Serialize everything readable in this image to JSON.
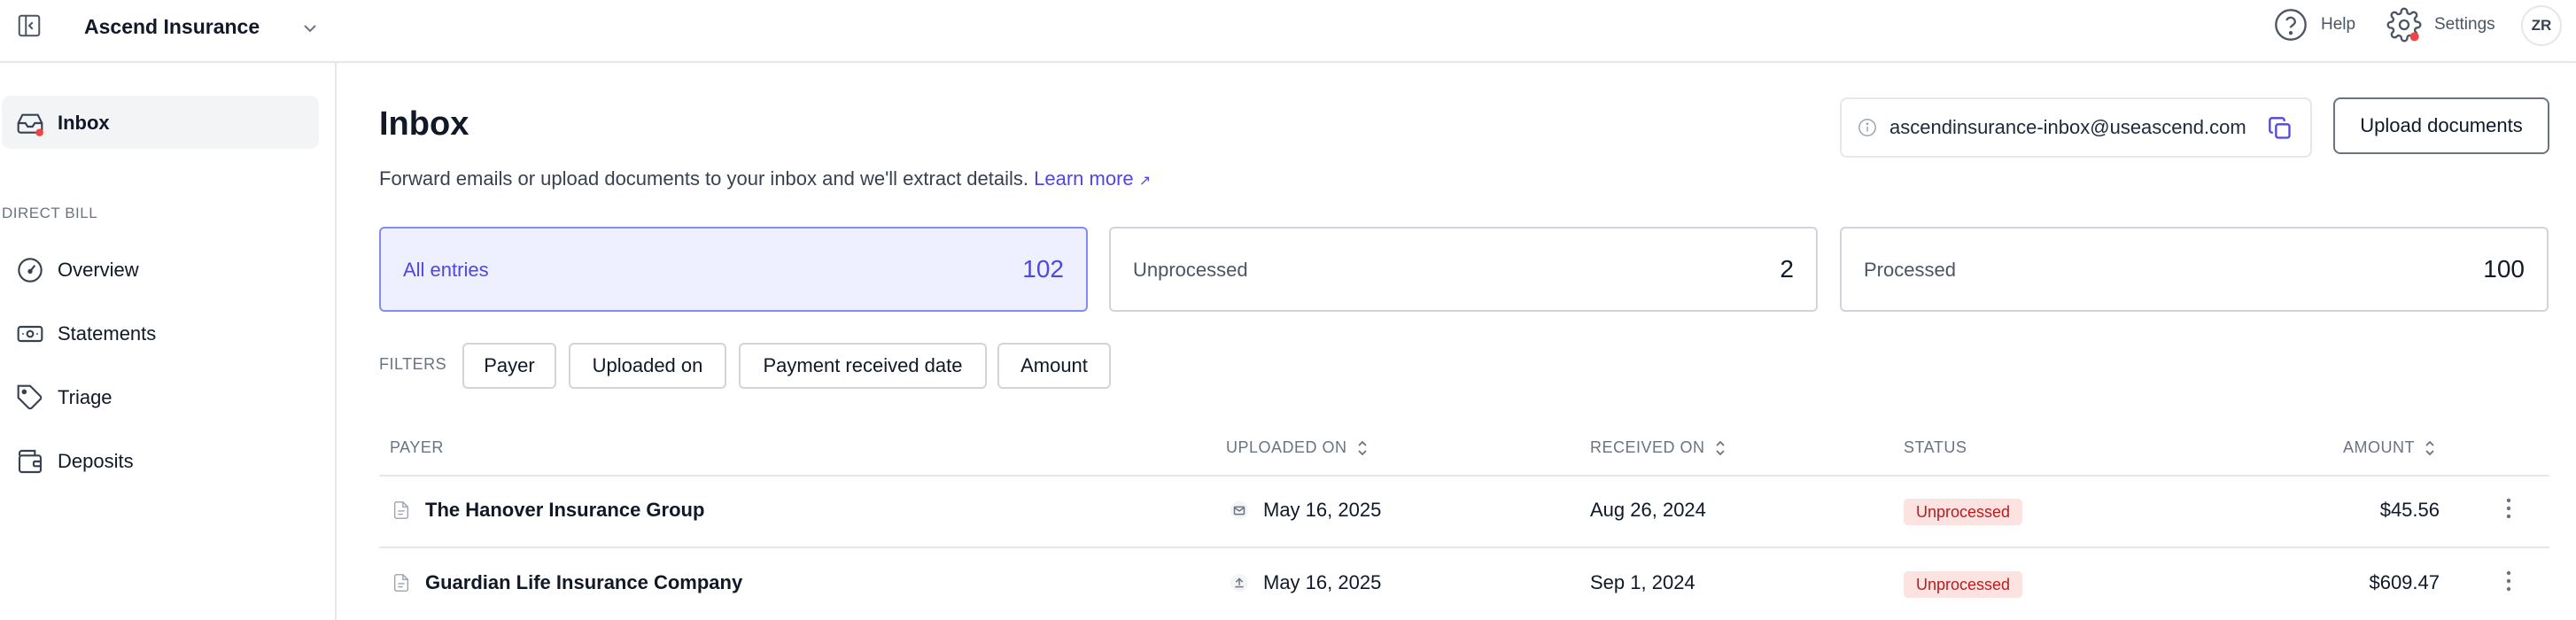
{
  "topbar": {
    "org_name": "Ascend Insurance",
    "help_label": "Help",
    "settings_label": "Settings",
    "avatar_initials": "ZR"
  },
  "sidebar": {
    "items": [
      {
        "label": "Inbox",
        "icon": "inbox-icon",
        "active": true
      },
      {
        "label": "Overview",
        "icon": "gauge-icon"
      },
      {
        "label": "Statements",
        "icon": "money-icon"
      },
      {
        "label": "Triage",
        "icon": "tag-icon"
      },
      {
        "label": "Deposits",
        "icon": "wallet-icon"
      }
    ],
    "section_label": "DIRECT BILL"
  },
  "main": {
    "title": "Inbox",
    "subtitle": "Forward emails or upload documents to your inbox and we'll extract details.",
    "learn_more": "Learn more",
    "inbox_email": "ascendinsurance-inbox@useascend.com",
    "upload_label": "Upload documents",
    "stats": [
      {
        "label": "All entries",
        "count": "102",
        "active": true
      },
      {
        "label": "Unprocessed",
        "count": "2"
      },
      {
        "label": "Processed",
        "count": "100"
      }
    ],
    "filters_label": "FILTERS",
    "filters": [
      "Payer",
      "Uploaded on",
      "Payment received date",
      "Amount"
    ]
  },
  "table": {
    "columns": {
      "payer": "PAYER",
      "uploaded_on": "UPLOADED ON",
      "received_on": "RECEIVED ON",
      "status": "STATUS",
      "amount": "AMOUNT"
    },
    "rows": [
      {
        "payer": "The Hanover Insurance Group",
        "source_icon": "mail-icon",
        "uploaded_on": "May 16, 2025",
        "received_on": "Aug 26, 2024",
        "status": "Unprocessed",
        "amount": "$45.56"
      },
      {
        "payer": "Guardian Life Insurance Company",
        "source_icon": "upload-icon",
        "uploaded_on": "May 16, 2025",
        "received_on": "Sep 1, 2024",
        "status": "Unprocessed",
        "amount": "$609.47"
      }
    ]
  },
  "colors": {
    "accent": "#4f46e5",
    "accent_bg": "#eeefff",
    "notification_dot": "#ef4444",
    "badge_bg": "#fde2e2",
    "badge_text": "#b91c1c"
  }
}
